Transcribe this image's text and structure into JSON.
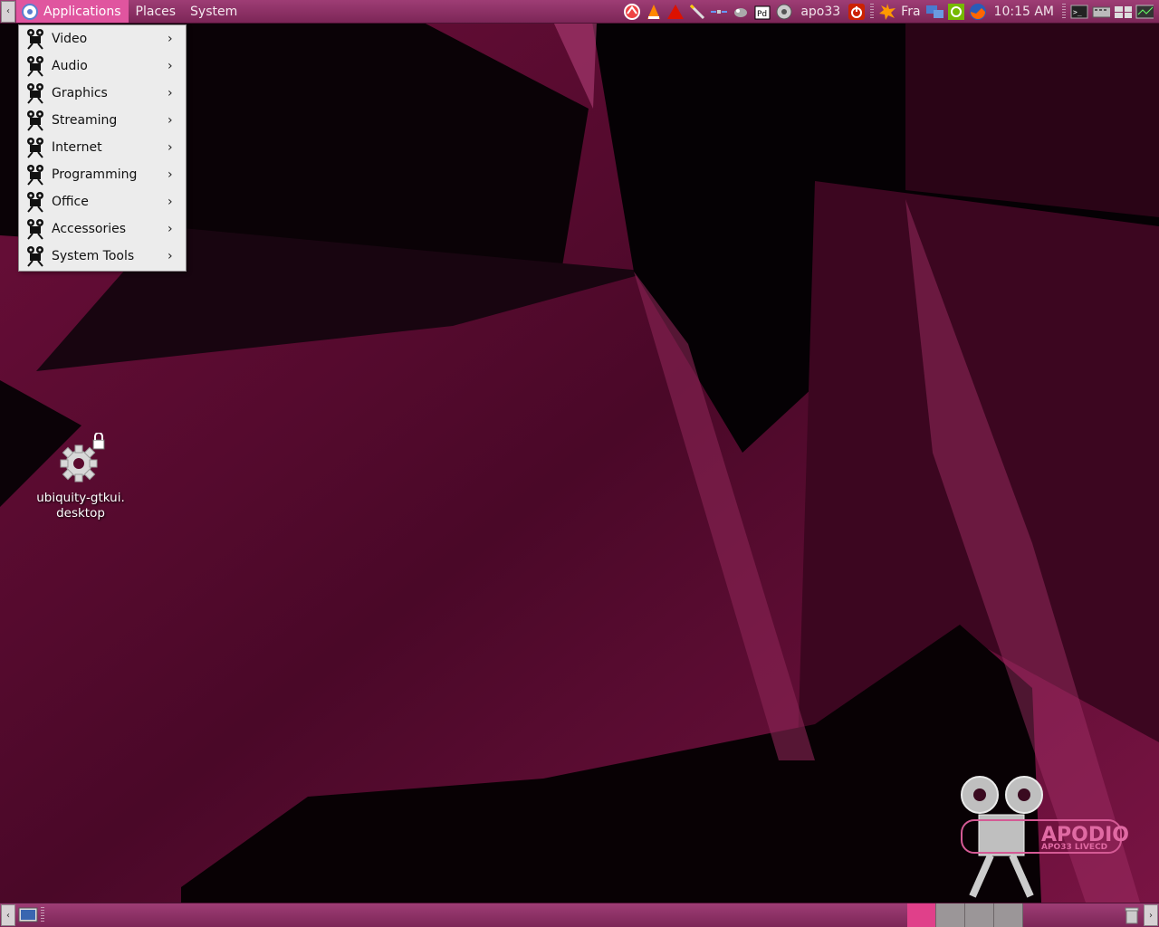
{
  "top_panel": {
    "left_arrow": "‹",
    "menus": {
      "applications": "Applications",
      "places": "Places",
      "system": "System"
    },
    "username": "apo33",
    "keyboard_layout": "Fra",
    "clock": "10:15 AM",
    "tray_icons": [
      "mail-icon",
      "vlc-icon",
      "acrobat-icon",
      "pen-icon",
      "satellite-icon",
      "bug-icon",
      "pd-icon",
      "network-icon",
      "power-icon",
      "starburst-icon",
      "network-monitor-icon",
      "nvidia-icon",
      "firefox-icon",
      "terminal-icon",
      "keyboard-icon",
      "workspace-icon",
      "monitor-icon"
    ]
  },
  "app_menu": {
    "items": [
      {
        "label": "Video",
        "arrow": "›"
      },
      {
        "label": "Audio",
        "arrow": "›"
      },
      {
        "label": "Graphics",
        "arrow": "›"
      },
      {
        "label": "Streaming",
        "arrow": "›"
      },
      {
        "label": "Internet",
        "arrow": "›"
      },
      {
        "label": "Programming",
        "arrow": "›"
      },
      {
        "label": "Office",
        "arrow": "›"
      },
      {
        "label": "Accessories",
        "arrow": "›"
      },
      {
        "label": "System Tools",
        "arrow": "›"
      }
    ]
  },
  "desktop": {
    "icon_label_line1": "ubiquity-gtkui.",
    "icon_label_line2": "desktop",
    "watermark_title": "APODIO",
    "watermark_subtitle": "APO33 LIVECD"
  },
  "bottom_panel": {
    "left_arrow": "‹",
    "right_arrow": "›",
    "workspaces": 4,
    "current_workspace": 1
  },
  "colors": {
    "panel": "#8c2f66",
    "menu_highlight": "#e0559f",
    "wallpaper_base": "#5a0b2e"
  }
}
